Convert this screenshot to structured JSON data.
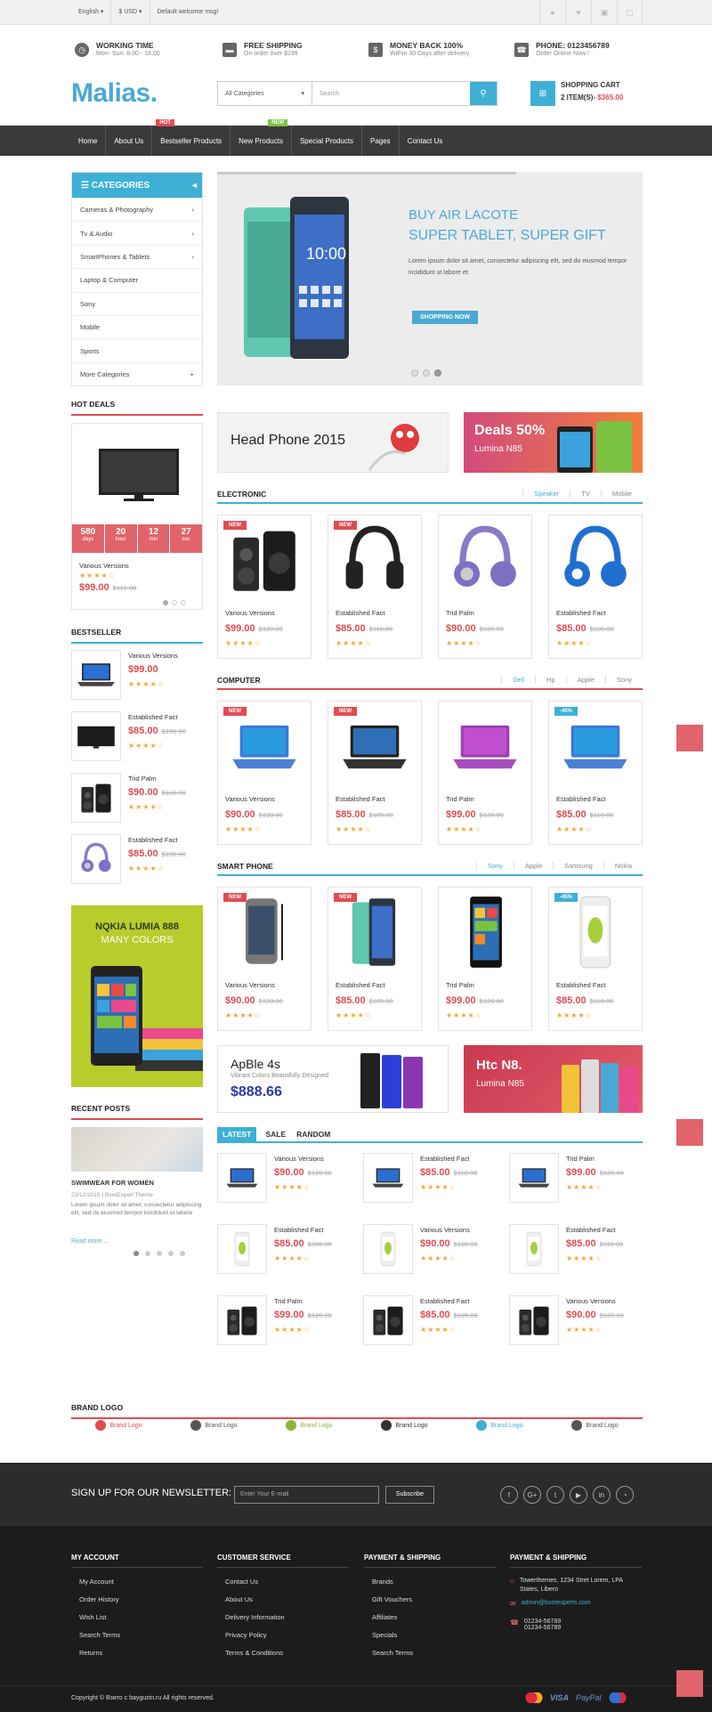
{
  "topbar": {
    "language": "English ▾",
    "currency": "$ USD ▾",
    "welcome": "Default welcome msg!"
  },
  "info": [
    {
      "title": "WORKING TIME",
      "sub": "Mon- Sun: 8.00 - 18.00"
    },
    {
      "title": "FREE SHIPPING",
      "sub": "On order over $199"
    },
    {
      "title": "MONEY BACK 100%",
      "sub": "Within 30 Days after delivery"
    },
    {
      "title": "PHONE: 0123456789",
      "sub": "Order Online Now !"
    }
  ],
  "logo": "Malias.",
  "search": {
    "category": "All Categories",
    "placeholder": "Search"
  },
  "cart": {
    "title": "SHOPPING CART",
    "items": "2 ITEM(S)-",
    "total": "$365.00"
  },
  "nav": {
    "items": [
      "Home",
      "About Us",
      "Bestseller Products",
      "New Products",
      "Special Products",
      "Pages",
      "Contact Us"
    ],
    "hot": "HOT",
    "new": "NEW"
  },
  "categories": {
    "title": "CATEGORIES",
    "items": [
      "Cameras & Photography",
      "Tv & Audio",
      "SmartPhones & Tablets",
      "Laptop & Computer",
      "Sony",
      "Mobile",
      "Sports",
      "More Categories"
    ]
  },
  "slider": {
    "title1": "BUY AIR LACOTE",
    "title2": "SUPER TABLET, SUPER GIFT",
    "text": "Lorem ipsum dolor sit amet, consectetur adipiscing elit, sed do eiusmod tempor incididunt ut labore et.",
    "button": "SHOPPING NOW"
  },
  "banners": {
    "headphone": "Head Phone 2015",
    "deals": "Deals 50%",
    "deals_sub": "Lumina N85"
  },
  "hotdeals": {
    "title": "HOT DEALS",
    "countdown": [
      {
        "v": "580",
        "l": "days"
      },
      {
        "v": "20",
        "l": "hour"
      },
      {
        "v": "12",
        "l": "min"
      },
      {
        "v": "27",
        "l": "sec"
      }
    ],
    "name": "Various Versions",
    "price": "$99.00",
    "old": "$110.00"
  },
  "bestseller": {
    "title": "BESTSELLER",
    "items": [
      {
        "name": "Various Versions",
        "price": "$99.00",
        "old": ""
      },
      {
        "name": "Established Fact",
        "price": "$85.00",
        "old": "$105.00"
      },
      {
        "name": "Trid Palm",
        "price": "$90.00",
        "old": "$120.00"
      },
      {
        "name": "Established Fact",
        "price": "$85.00",
        "old": "$105.00"
      }
    ]
  },
  "sidebanner": {
    "l1": "NQKIA LUMIA 888",
    "l2": "MANY COLORS"
  },
  "recent": {
    "title": "RECENT POSTS",
    "post": "SWIMWEAR FOR WOMEN",
    "meta": "23/12/2015 | BootExpert Theme",
    "text": "Lorem ipsum dolor sit amet, consectetur adipiscing elit, sed do eiusmod tempor incididunt ut labore",
    "more": "Read more ..."
  },
  "electronic": {
    "title": "ELECTRONIC",
    "tabs": [
      "Speaker",
      "TV",
      "Mobile"
    ],
    "products": [
      {
        "name": "Various Versions",
        "price": "$99.00",
        "old": "$120.00",
        "badge": "NEW"
      },
      {
        "name": "Established Fact",
        "price": "$85.00",
        "old": "$110.00",
        "badge": "NEW"
      },
      {
        "name": "Trid Palm",
        "price": "$90.00",
        "old": "$120.00",
        "badge": ""
      },
      {
        "name": "Established Fact",
        "price": "$85.00",
        "old": "$105.00",
        "badge": ""
      }
    ]
  },
  "computer": {
    "title": "COMPUTER",
    "tabs": [
      "Dell",
      "Hp",
      "Apple",
      "Sony"
    ],
    "products": [
      {
        "name": "Various Versions",
        "price": "$90.00",
        "old": "$120.00",
        "badge": "NEW"
      },
      {
        "name": "Established Fact",
        "price": "$85.00",
        "old": "$105.00",
        "badge": "NEW"
      },
      {
        "name": "Trid Palm",
        "price": "$99.00",
        "old": "$120.00",
        "badge": ""
      },
      {
        "name": "Established Fact",
        "price": "$85.00",
        "old": "$110.00",
        "badge": "-45%"
      }
    ]
  },
  "smartphone": {
    "title": "SMART PHONE",
    "tabs": [
      "Sony",
      "Apple",
      "Samsung",
      "Nokia"
    ],
    "products": [
      {
        "name": "Various Versions",
        "price": "$90.00",
        "old": "$120.00",
        "badge": "NEW"
      },
      {
        "name": "Established Fact",
        "price": "$85.00",
        "old": "$105.00",
        "badge": "NEW"
      },
      {
        "name": "Trid Palm",
        "price": "$99.00",
        "old": "$120.00",
        "badge": ""
      },
      {
        "name": "Established Fact",
        "price": "$85.00",
        "old": "$110.00",
        "badge": "-45%"
      }
    ]
  },
  "apple": {
    "title": "ApBle 4s",
    "sub": "Vibrant Colors Beautifully Designed",
    "price": "$888.66"
  },
  "htc": {
    "title": "Htc N8.",
    "sub": "Lumina N85"
  },
  "latest": {
    "tabs": [
      "LATEST",
      "SALE",
      "RANDOM"
    ],
    "items": [
      {
        "name": "Various Versions",
        "price": "$90.00",
        "old": "$120.00"
      },
      {
        "name": "Established Fact",
        "price": "$85.00",
        "old": "$110.00"
      },
      {
        "name": "Trid Palm",
        "price": "$99.00",
        "old": "$120.00"
      },
      {
        "name": "Established Fact",
        "price": "$85.00",
        "old": "$105.00"
      },
      {
        "name": "Various Versions",
        "price": "$90.00",
        "old": "$120.00"
      },
      {
        "name": "Established Fact",
        "price": "$85.00",
        "old": "$110.00"
      },
      {
        "name": "Trid Palm",
        "price": "$99.00",
        "old": "$120.00"
      },
      {
        "name": "Established Fact",
        "price": "$85.00",
        "old": "$105.00"
      },
      {
        "name": "Various Versions",
        "price": "$90.00",
        "old": "$120.00"
      }
    ]
  },
  "brand": {
    "title": "BRAND LOGO",
    "logos": [
      "Brand Logo",
      "Brand Logo",
      "Brand Logo",
      "Brand Logo",
      "Brand Logo",
      "Brand Logo"
    ]
  },
  "newsletter": {
    "label": "SIGN UP FOR OUR NEWSLETTER:",
    "placeholder": "Enter Your E-mail",
    "button": "Subscribe"
  },
  "footer": {
    "account": {
      "title": "MY ACCOUNT",
      "links": [
        "My Account",
        "Order History",
        "Wish List",
        "Search Terms",
        "Returns"
      ]
    },
    "service": {
      "title": "CUSTOMER SERVICE",
      "links": [
        "Contact Us",
        "About Us",
        "Delivery Information",
        "Privacy Policy",
        "Terms & Conditions"
      ]
    },
    "payment": {
      "title": "PAYMENT & SHIPPING",
      "links": [
        "Brands",
        "Gift Vouchers",
        "Affiliates",
        "Specials",
        "Search Terms"
      ]
    },
    "contact": {
      "title": "PAYMENT & SHIPPING",
      "address": "Towerthemes, 1234 Stret Lorem, LPA States, Libero",
      "email": "admin@bootexperts.com",
      "phone1": "01234-56789",
      "phone2": "01234-56789"
    },
    "copyright": "Copyright © Взято с bayguzin.ru All rights reserved.",
    "payments": [
      "VISA",
      "PayPal"
    ]
  }
}
